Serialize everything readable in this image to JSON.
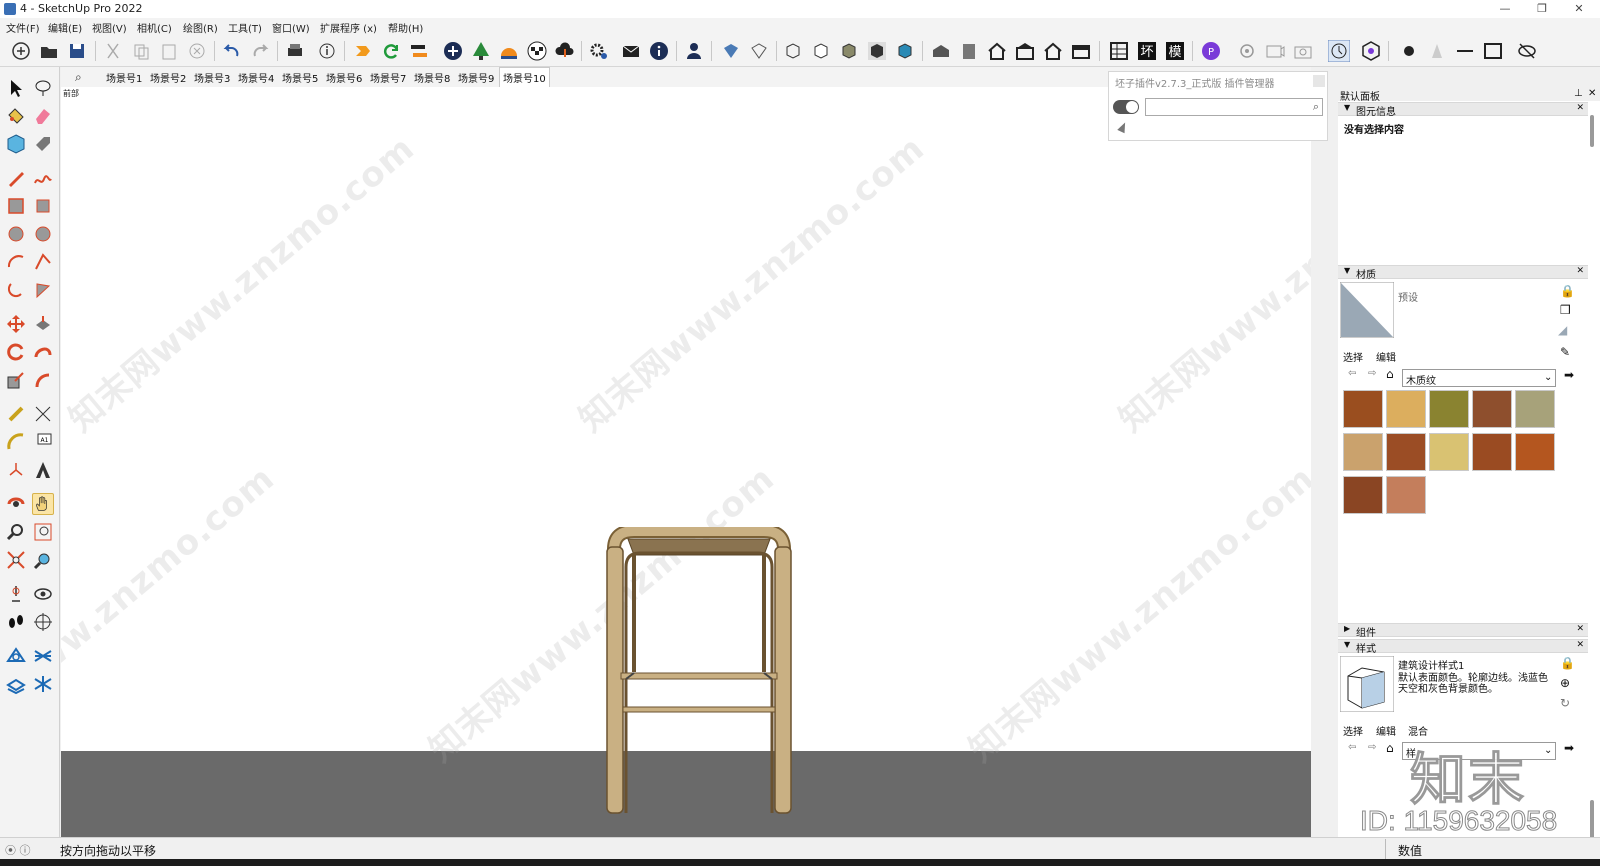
{
  "window": {
    "title": "4 - SketchUp Pro 2022",
    "minimize": "—",
    "maximize": "❐",
    "close": "✕"
  },
  "menu": [
    "文件(F)",
    "编辑(E)",
    "视图(V)",
    "相机(C)",
    "绘图(R)",
    "工具(T)",
    "窗口(W)",
    "扩展程序 (x)",
    "帮助(H)"
  ],
  "scenes": {
    "tabs": [
      "场景号1",
      "场景号2",
      "场景号3",
      "场景号4",
      "场景号5",
      "场景号6",
      "场景号7",
      "场景号8",
      "场景号9",
      "场景号10"
    ],
    "active_index": 9
  },
  "viewport": {
    "view_label": "前部",
    "watermark": "知末网www.znzmo.com"
  },
  "plugin": {
    "title": "坯子插件v2.7.3_正式版 插件管理器",
    "search_placeholder": "",
    "search_icon": "search-icon"
  },
  "tray": {
    "title": "默认面板",
    "entity_info": {
      "label": "图元信息",
      "content": "没有选择内容"
    },
    "materials": {
      "label": "材质",
      "preview_name": "预设",
      "tabs": [
        "选择",
        "编辑"
      ],
      "library": "木质纹",
      "swatches": [
        "#9a4e1f",
        "#dcae5e",
        "#8a8330",
        "#8e4f2d",
        "#a7a27a",
        "#caa26d",
        "#9b4d25",
        "#d9c272",
        "#9a4b22",
        "#b4561f",
        "#8a4523",
        "#c47e5c"
      ]
    },
    "components": {
      "label": "组件"
    },
    "styles": {
      "label": "样式",
      "style_name": "建筑设计样式1",
      "style_desc": "默认表面颜色。轮廓边线。浅蓝色天空和灰色背景颜色。",
      "tabs": [
        "选择",
        "编辑",
        "混合"
      ],
      "library": "样"
    }
  },
  "status": {
    "message": "按方向拖动以平移",
    "value_label": "数值"
  },
  "overlay": {
    "brand": "知末",
    "id_text": "ID: 1159632058"
  }
}
